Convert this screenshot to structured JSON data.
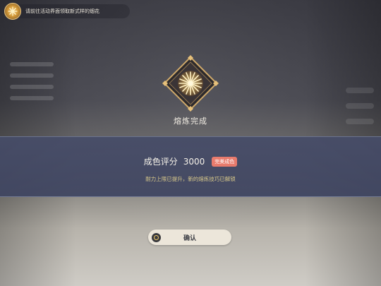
{
  "notice": {
    "text": "请前往活动界面领取新式样的烟花",
    "icon": "firework-icon"
  },
  "result": {
    "title": "熔炼完成",
    "emblem_icon": "firework-emblem-icon"
  },
  "score": {
    "label": "成色评分",
    "value": "3000",
    "badge": "完美成色",
    "subtext": "耐力上限已提升，新的熔炼技巧已解锁"
  },
  "confirm_button": {
    "label": "确认",
    "icon": "circle-confirm-icon"
  },
  "colors": {
    "band": "#464c68",
    "badge": "#e87b6d",
    "subtext": "#d9c98a",
    "gold": "#e9c070"
  }
}
